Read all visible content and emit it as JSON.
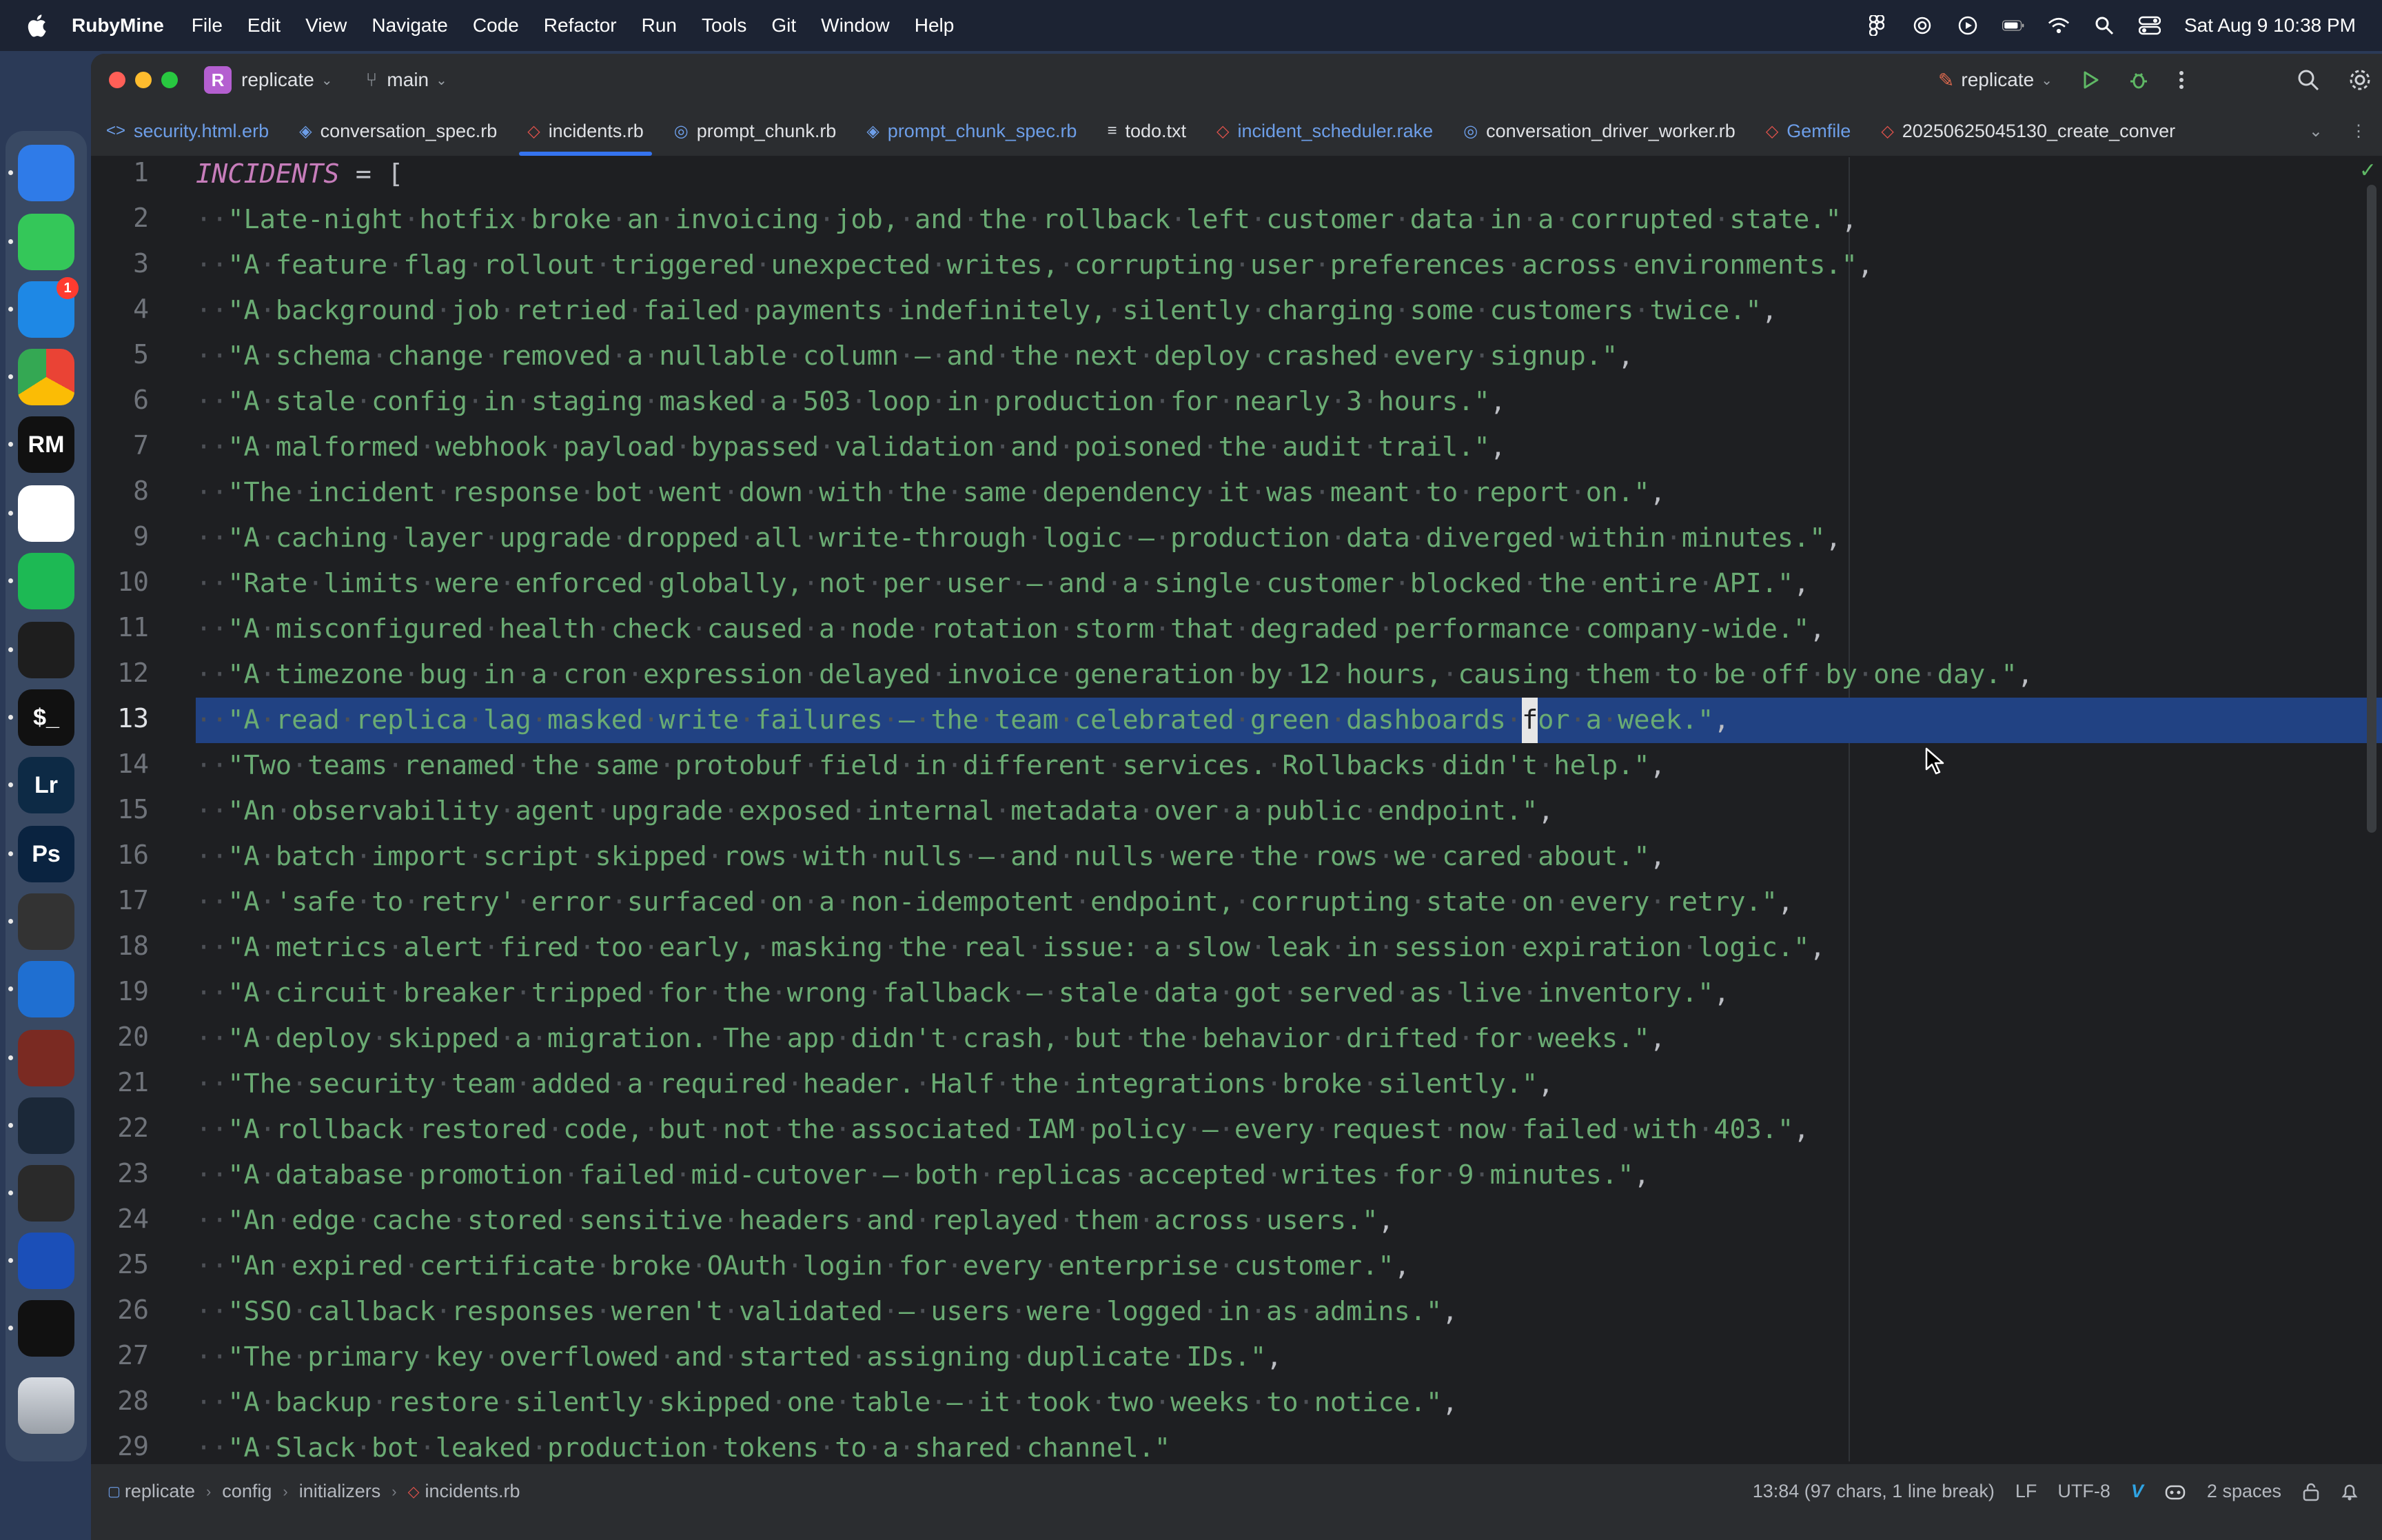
{
  "menubar": {
    "app_name": "RubyMine",
    "items": [
      "File",
      "Edit",
      "View",
      "Navigate",
      "Code",
      "Refactor",
      "Run",
      "Tools",
      "Git",
      "Window",
      "Help"
    ],
    "clock": "Sat Aug 9  10:38 PM"
  },
  "dock": {
    "apps": [
      {
        "name": "Finder",
        "label": "",
        "color": "#2f7be8"
      },
      {
        "name": "Messages",
        "label": "",
        "color": "#34c759"
      },
      {
        "name": "Airmail",
        "label": "",
        "color": "#1e88e5",
        "badge": "1"
      },
      {
        "name": "Chrome",
        "label": "",
        "color": "#ffffff"
      },
      {
        "name": "RubyMine",
        "label": "RM",
        "color": "#111111"
      },
      {
        "name": "ChatGPT",
        "label": "",
        "color": "#ffffff"
      },
      {
        "name": "Spotify",
        "label": "",
        "color": "#1db954"
      },
      {
        "name": "Figma",
        "label": "",
        "color": "#1e1e1e"
      },
      {
        "name": "Terminal",
        "label": "$_",
        "color": "#111111"
      },
      {
        "name": "Lightroom",
        "label": "Lr",
        "color": "#0d2a45"
      },
      {
        "name": "Photoshop",
        "label": "Ps",
        "color": "#0a2340"
      },
      {
        "name": "Final Cut Pro",
        "label": "",
        "color": "#333333"
      },
      {
        "name": "Proxyman",
        "label": "",
        "color": "#1f6fd1"
      },
      {
        "name": "Brave",
        "label": "",
        "color": "#7a2a22"
      },
      {
        "name": "Steam",
        "label": "",
        "color": "#1b2838"
      },
      {
        "name": "OBS",
        "label": "",
        "color": "#2a2a2a"
      },
      {
        "name": "Audacity",
        "label": "",
        "color": "#1b4fb8"
      },
      {
        "name": "Activity Monitor",
        "label": "",
        "color": "#111111"
      },
      {
        "name": "Trash",
        "label": "",
        "color": "#b8bcc2"
      }
    ]
  },
  "titlebar": {
    "project_badge": "R",
    "project": "replicate",
    "branch": "main",
    "run_config": "replicate"
  },
  "tabs": [
    {
      "label": "security.html.erb",
      "icon": "<>",
      "active": false,
      "blue": true
    },
    {
      "label": "conversation_spec.rb",
      "icon": "◈",
      "active": false,
      "blue": false
    },
    {
      "label": "incidents.rb",
      "icon": "◇",
      "active": true,
      "blue": false
    },
    {
      "label": "prompt_chunk.rb",
      "icon": "◎",
      "active": false,
      "blue": false
    },
    {
      "label": "prompt_chunk_spec.rb",
      "icon": "◈",
      "active": false,
      "blue": true
    },
    {
      "label": "todo.txt",
      "icon": "≡",
      "active": false,
      "blue": false
    },
    {
      "label": "incident_scheduler.rake",
      "icon": "◇",
      "active": false,
      "blue": true
    },
    {
      "label": "conversation_driver_worker.rb",
      "icon": "◎",
      "active": false,
      "blue": false
    },
    {
      "label": "Gemfile",
      "icon": "◇",
      "active": false,
      "blue": true
    },
    {
      "label": "20250625045130_create_conver",
      "icon": "◇",
      "active": false,
      "blue": false
    }
  ],
  "editor": {
    "current_line": 13,
    "first_line": {
      "constant": "INCIDENTS",
      "rest": " = ["
    },
    "lines": [
      "\"Late-night hotfix broke an invoicing job, and the rollback left customer data in a corrupted state.\",",
      "\"A feature flag rollout triggered unexpected writes, corrupting user preferences across environments.\",",
      "\"A background job retried failed payments indefinitely, silently charging some customers twice.\",",
      "\"A schema change removed a nullable column — and the next deploy crashed every signup.\",",
      "\"A stale config in staging masked a 503 loop in production for nearly 3 hours.\",",
      "\"A malformed webhook payload bypassed validation and poisoned the audit trail.\",",
      "\"The incident response bot went down with the same dependency it was meant to report on.\",",
      "\"A caching layer upgrade dropped all write-through logic — production data diverged within minutes.\",",
      "\"Rate limits were enforced globally, not per user — and a single customer blocked the entire API.\",",
      "\"A misconfigured health check caused a node rotation storm that degraded performance company-wide.\",",
      "\"A timezone bug in a cron expression delayed invoice generation by 12 hours, causing them to be off by one day.\",",
      "\"A read replica lag masked write failures — the team celebrated green dashboards for a week.\",",
      "\"Two teams renamed the same protobuf field in different services. Rollbacks didn't help.\",",
      "\"An observability agent upgrade exposed internal metadata over a public endpoint.\",",
      "\"A batch import script skipped rows with nulls — and nulls were the rows we cared about.\",",
      "\"A 'safe to retry' error surfaced on a non-idempotent endpoint, corrupting state on every retry.\",",
      "\"A metrics alert fired too early, masking the real issue: a slow leak in session expiration logic.\",",
      "\"A circuit breaker tripped for the wrong fallback — stale data got served as live inventory.\",",
      "\"A deploy skipped a migration. The app didn't crash, but the behavior drifted for weeks.\",",
      "\"The security team added a required header. Half the integrations broke silently.\",",
      "\"A rollback restored code, but not the associated IAM policy — every request now failed with 403.\",",
      "\"A database promotion failed mid-cutover — both replicas accepted writes for 9 minutes.\",",
      "\"An edge cache stored sensitive headers and replayed them across users.\",",
      "\"An expired certificate broke OAuth login for every enterprise customer.\",",
      "\"SSO callback responses weren't validated — users were logged in as admins.\",",
      "\"The primary key overflowed and started assigning duplicate IDs.\",",
      "\"A backup restore silently skipped one table — it took two weeks to notice.\",",
      "\"A Slack bot leaked production tokens to a shared channel.\""
    ]
  },
  "statusbar": {
    "breadcrumbs": [
      "replicate",
      "config",
      "initializers",
      "incidents.rb"
    ],
    "position": "13:84 (97 chars, 1 line break)",
    "line_separator": "LF",
    "encoding": "UTF-8",
    "indent": "2 spaces"
  },
  "colors": {
    "accent": "#3574f0",
    "selection": "#214283",
    "string": "#6aab73",
    "constant": "#c77dbb"
  }
}
